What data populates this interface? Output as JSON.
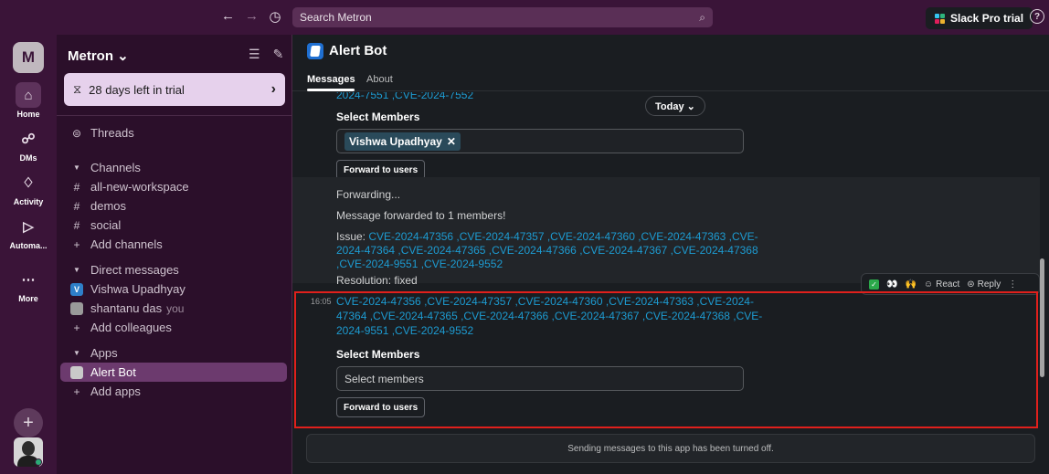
{
  "topbar": {
    "back": "←",
    "forward": "→",
    "history": "◷",
    "search_placeholder": "Search Metron",
    "pro_label": "Slack Pro trial",
    "help": "?"
  },
  "workspace": {
    "initial": "M",
    "name": "Metron ⌄"
  },
  "rail": [
    {
      "icon": "⌂",
      "label": "Home"
    },
    {
      "icon": "☍",
      "label": "DMs"
    },
    {
      "icon": "♢",
      "label": "Activity"
    },
    {
      "icon": "▷",
      "label": "Automa..."
    },
    {
      "icon": "⋯",
      "label": "More"
    }
  ],
  "rail_plus": "+",
  "sidebar": {
    "filter_icon": "☰",
    "compose_icon": "✎",
    "trial": {
      "icon": "⧖",
      "label": "28 days left in trial",
      "chevron": "›"
    },
    "threads": "Threads",
    "channels_header": "Channels",
    "channels": [
      "all-new-workspace",
      "demos",
      "social"
    ],
    "add_channels": "Add channels",
    "dm_header": "Direct messages",
    "dms": [
      {
        "name": "Vishwa Upadhyay",
        "initial": "V",
        "color": "#2e7fc9",
        "suffix": ""
      },
      {
        "name": "shantanu das",
        "initial": "",
        "color": "#9a9a9a",
        "suffix": "you"
      }
    ],
    "add_colleagues": "Add colleagues",
    "apps_header": "Apps",
    "apps": [
      "Alert Bot"
    ],
    "add_apps": "Add apps"
  },
  "channel": {
    "title": "Alert Bot",
    "tabs": [
      "Messages",
      "About"
    ]
  },
  "messages": {
    "today": "Today ⌄",
    "top_clip": "2024-7551 ,CVE-2024-7552",
    "select_members_1": "Select Members",
    "selected_member": "Vishwa Upadhyay",
    "chip_close": "✕",
    "forward_btn_1": "Forward to users",
    "forwarding": "Forwarding...",
    "forwarded": "Message forwarded to 1 members!",
    "issue_label": "Issue: ",
    "issue_lines": [
      "CVE-2024-47356 ,CVE-2024-47357 ,CVE-2024-47360 ,CVE-2024-47363 ,CVE-",
      "2024-47364 ,CVE-2024-47365 ,CVE-2024-47366 ,CVE-2024-47367 ,CVE-2024-47368",
      ",CVE-2024-9551 ,CVE-2024-9552"
    ],
    "resolution": "Resolution: fixed",
    "timestamp": "16:05",
    "cve_lines": [
      "CVE-2024-47356 ,CVE-2024-47357 ,CVE-2024-47360 ,CVE-2024-47363 ,CVE-2024-",
      "47364 ,CVE-2024-47365 ,CVE-2024-47366 ,CVE-2024-47367 ,CVE-2024-47368 ,CVE-",
      "2024-9551 ,CVE-2024-9552"
    ],
    "select_members_2": "Select Members",
    "select_placeholder": "Select members",
    "forward_btn_2": "Forward to users"
  },
  "reactions": {
    "eyes": "👀",
    "hands": "🙌",
    "react": "React",
    "reply": "Reply",
    "more": "⋮",
    "react_icon": "☺",
    "reply_icon": "⊜"
  },
  "composer": {
    "disabled_text": "Sending messages to this app has been turned off."
  }
}
